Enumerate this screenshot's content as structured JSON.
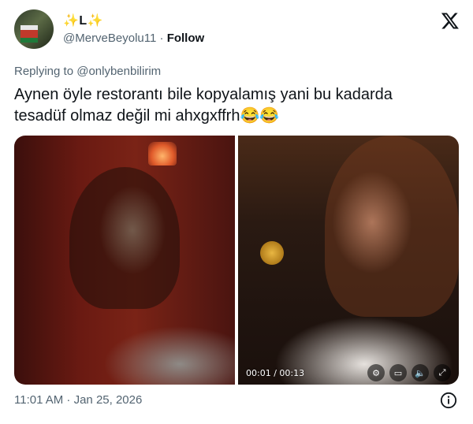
{
  "author": {
    "display_name": "✨L✨",
    "handle": "@MerveBeyolu11",
    "separator": "·",
    "follow_label": "Follow"
  },
  "reply": {
    "prefix": "Replying to",
    "mention": "@onlybenbilirim"
  },
  "tweet": {
    "text_line1": "Aynen öyle restorantı bile kopyalamış yani bu kadarda",
    "text_line2": "tesadüf olmaz değil mi ahxgxffrh😂😂"
  },
  "media": {
    "video_time": "00:01 / 00:13",
    "controls": [
      "settings-icon",
      "picture-in-picture-icon",
      "airplay-icon",
      "mute-icon",
      "fullscreen-icon"
    ]
  },
  "meta": {
    "timestamp": "11:01 AM · Jan 25, 2026"
  },
  "colors": {
    "text": "#0f1419",
    "muted": "#536471"
  }
}
